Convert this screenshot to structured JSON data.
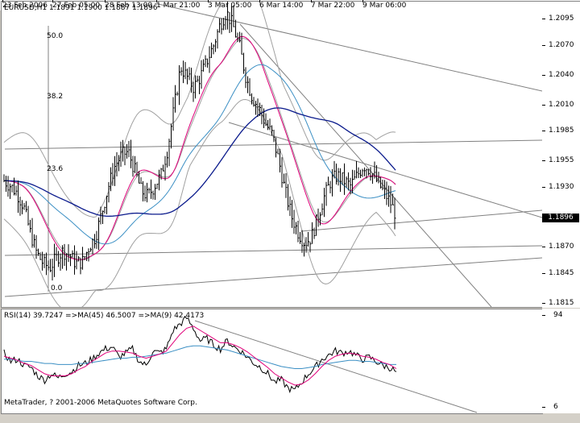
{
  "window": {
    "symbol_header": "EURUSD,H1  1.1891 1.1900 1.1887 1.1896",
    "copyright": "MetaQuotes Software Corp."
  },
  "fibonacci": {
    "levels": [
      {
        "label": "50.0",
        "price": 1.2079
      },
      {
        "label": "38.2",
        "price": 1.2024
      },
      {
        "label": "23.6",
        "price": 1.1954
      },
      {
        "label": "0.0",
        "price": 1.1839
      }
    ]
  },
  "price_axis": {
    "labels": [
      "1.2095",
      "1.2070",
      "1.2040",
      "1.2010",
      "1.1985",
      "1.1955",
      "1.1930",
      "1.1896",
      "1.1870",
      "1.1845",
      "1.1815"
    ],
    "values": [
      1.2095,
      1.207,
      1.204,
      1.201,
      1.1985,
      1.1955,
      1.193,
      1.1896,
      1.187,
      1.1845,
      1.1815
    ],
    "current_price": "1.1896",
    "range": [
      1.1808,
      1.2103
    ]
  },
  "rsi": {
    "header": "RSI(14) 39.7247  =>MA(45) 46.5007  =>MA(9) 42.4173",
    "axis_labels": [
      "94",
      "6"
    ],
    "range": [
      6,
      94
    ]
  },
  "time_axis": {
    "labels": [
      "23 Feb 2006",
      "27 Feb 05:00",
      "28 Feb 13:00",
      "1 Mar 21:00",
      "3 Mar 05:00",
      "6 Mar 14:00",
      "7 Mar 22:00",
      "9 Mar 06:00"
    ]
  },
  "colors": {
    "background": "#ffffff",
    "bars": "#000000",
    "bollinger": "#a0a0a0",
    "ma_fast": "#e0007a",
    "ma_mid": "#3b8fc4",
    "ma_slow": "#0a1a8c",
    "trendline": "#808080",
    "rsi_line": "#000000"
  },
  "chart_data": [
    {
      "type": "line",
      "title": "EURUSD,H1",
      "x_range": [
        "23 Feb 2006",
        "9 Mar 2006"
      ],
      "price_range": [
        1.1808,
        1.2103
      ],
      "close_path": [
        1.193,
        1.1925,
        1.1918,
        1.1905,
        1.188,
        1.186,
        1.185,
        1.1846,
        1.1855,
        1.1862,
        1.1858,
        1.185,
        1.1852,
        1.1866,
        1.1876,
        1.19,
        1.1925,
        1.1945,
        1.1955,
        1.1958,
        1.194,
        1.192,
        1.1915,
        1.1925,
        1.1935,
        1.196,
        1.2,
        1.204,
        1.203,
        1.202,
        1.203,
        1.2045,
        1.206,
        1.208,
        1.2093,
        1.208,
        1.206,
        1.203,
        1.201,
        1.2,
        1.1985,
        1.1975,
        1.195,
        1.192,
        1.1895,
        1.188,
        1.187,
        1.1875,
        1.1895,
        1.1915,
        1.193,
        1.1935,
        1.193,
        1.1925,
        1.1935,
        1.1945,
        1.194,
        1.193,
        1.192,
        1.191,
        1.1896
      ]
    },
    {
      "type": "line",
      "title": "RSI(14)",
      "y_range": [
        6,
        94
      ],
      "series": [
        {
          "name": "RSI(14)",
          "values": [
            58,
            50,
            52,
            46,
            44,
            36,
            32,
            38,
            34,
            38,
            40,
            46,
            48,
            52,
            58,
            62,
            64,
            54,
            58,
            62,
            50,
            46,
            60,
            58,
            62,
            80,
            86,
            92,
            82,
            70,
            72,
            66,
            62,
            70,
            64,
            60,
            54,
            48,
            44,
            38,
            30,
            32,
            24,
            22,
            30,
            38,
            44,
            52,
            56,
            60,
            58,
            60,
            56,
            52,
            54,
            50,
            46,
            44,
            40
          ]
        },
        {
          "name": "MA(45)",
          "values": [
            52,
            52,
            51,
            50,
            50,
            49,
            48,
            48,
            47,
            47,
            47,
            48,
            48,
            49,
            50,
            51,
            52,
            53,
            53,
            54,
            54,
            55,
            56,
            57,
            58,
            60,
            62,
            64,
            65,
            65,
            64,
            63,
            62,
            61,
            59,
            57,
            55,
            53,
            51,
            49,
            47,
            45,
            44,
            43,
            43,
            44,
            45,
            47,
            48,
            49,
            50,
            51,
            51,
            50,
            50,
            49,
            48,
            47,
            47
          ]
        },
        {
          "name": "MA(9)",
          "values": [
            55,
            53,
            51,
            48,
            46,
            42,
            38,
            36,
            36,
            36,
            38,
            42,
            45,
            50,
            54,
            58,
            60,
            60,
            59,
            58,
            55,
            53,
            55,
            57,
            60,
            68,
            76,
            82,
            84,
            80,
            76,
            72,
            68,
            68,
            66,
            63,
            59,
            54,
            49,
            44,
            38,
            34,
            30,
            27,
            28,
            32,
            38,
            45,
            51,
            55,
            57,
            58,
            57,
            55,
            54,
            52,
            49,
            47,
            43
          ]
        }
      ]
    }
  ]
}
